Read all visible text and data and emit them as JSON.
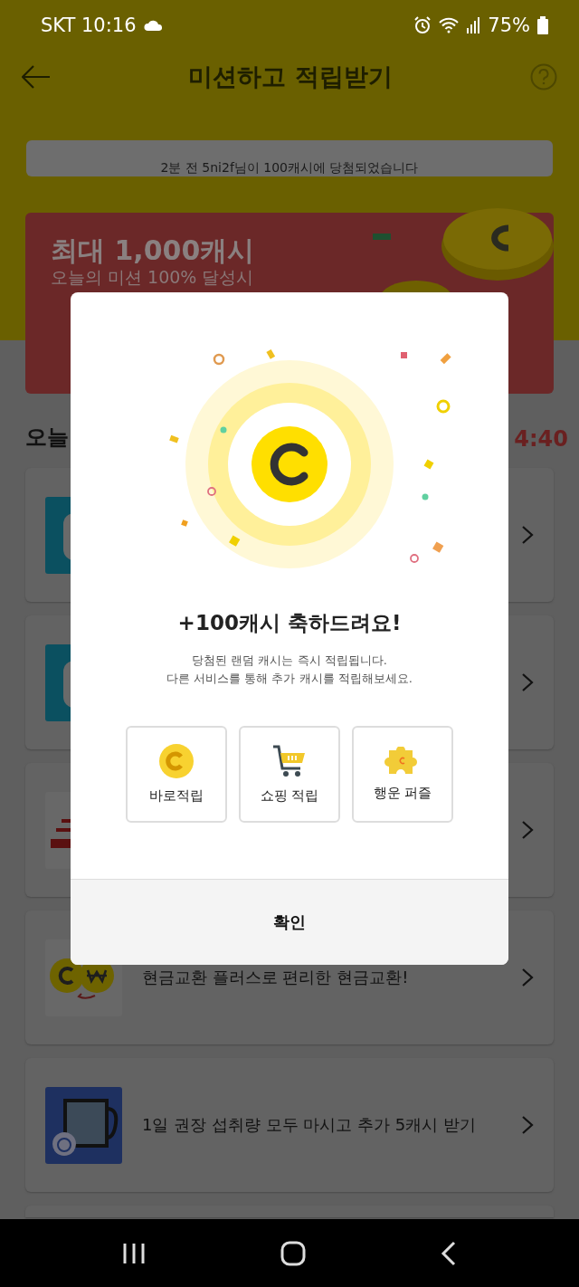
{
  "status_bar": {
    "carrier_time": "SKT 10:16",
    "battery": "75%"
  },
  "header": {
    "title": "미션하고 적립받기"
  },
  "toast": {
    "text": "2분 전 5ni2f님이 100캐시에 당첨되었습니다"
  },
  "banner": {
    "title": "최대 1,000캐시",
    "subtitle": "오늘의 미션 100% 달성시"
  },
  "section": {
    "title": "오늘",
    "timer": "4:40"
  },
  "missions": [
    {
      "kind": "app"
    },
    {
      "kind": "app"
    },
    {
      "kind": "news"
    },
    {
      "kind": "exchange",
      "text": "현금교환 플러스로 편리한 현금교환!"
    },
    {
      "kind": "water",
      "text": "1일 권장 섭취량 모두 마시고 추가 5캐시 받기"
    }
  ],
  "dialog": {
    "title": "+100캐시 축하드려요!",
    "message": [
      "당첨된 랜덤 캐시는 즉시 적립됩니다.",
      "다른 서비스를 통해 추가 캐시를 적립해보세요."
    ],
    "options": [
      {
        "kind": "coin",
        "label": "바로적립"
      },
      {
        "kind": "cart",
        "label": "쇼핑 적립"
      },
      {
        "kind": "puzzle",
        "label": "행운 퍼즐"
      }
    ],
    "confirm": "확인"
  }
}
